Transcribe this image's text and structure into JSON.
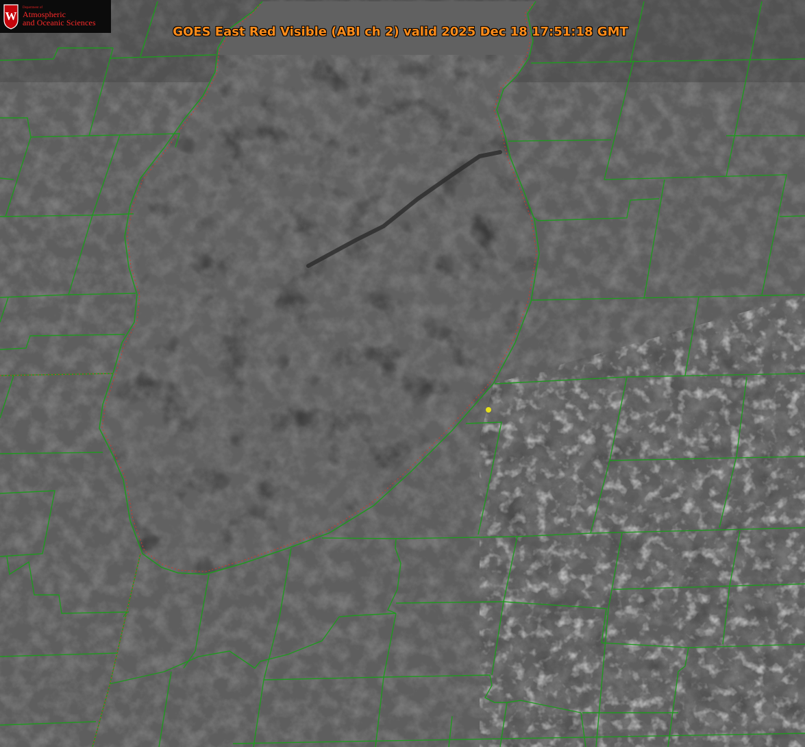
{
  "header": {
    "title": "GOES East Red Visible (ABI ch 2) valid 2025 Dec 18 17:51:18 GMT"
  },
  "logo": {
    "department": "Department of",
    "line1": "Atmospheric",
    "line2": "and Oceanic Sciences",
    "crest_letter": "W",
    "crest_icon": "wisconsin-crest-icon"
  },
  "colors": {
    "title": "#ff8c1a",
    "boundaries": "#1f9a1f",
    "shoreline_dotted": "#d23a2a",
    "marker": "#e6e01a",
    "logo_text": "#ff2a2a"
  },
  "map": {
    "layers": [
      "visible-satellite-imagery",
      "county-boundaries",
      "lake-shoreline",
      "location-marker"
    ]
  }
}
